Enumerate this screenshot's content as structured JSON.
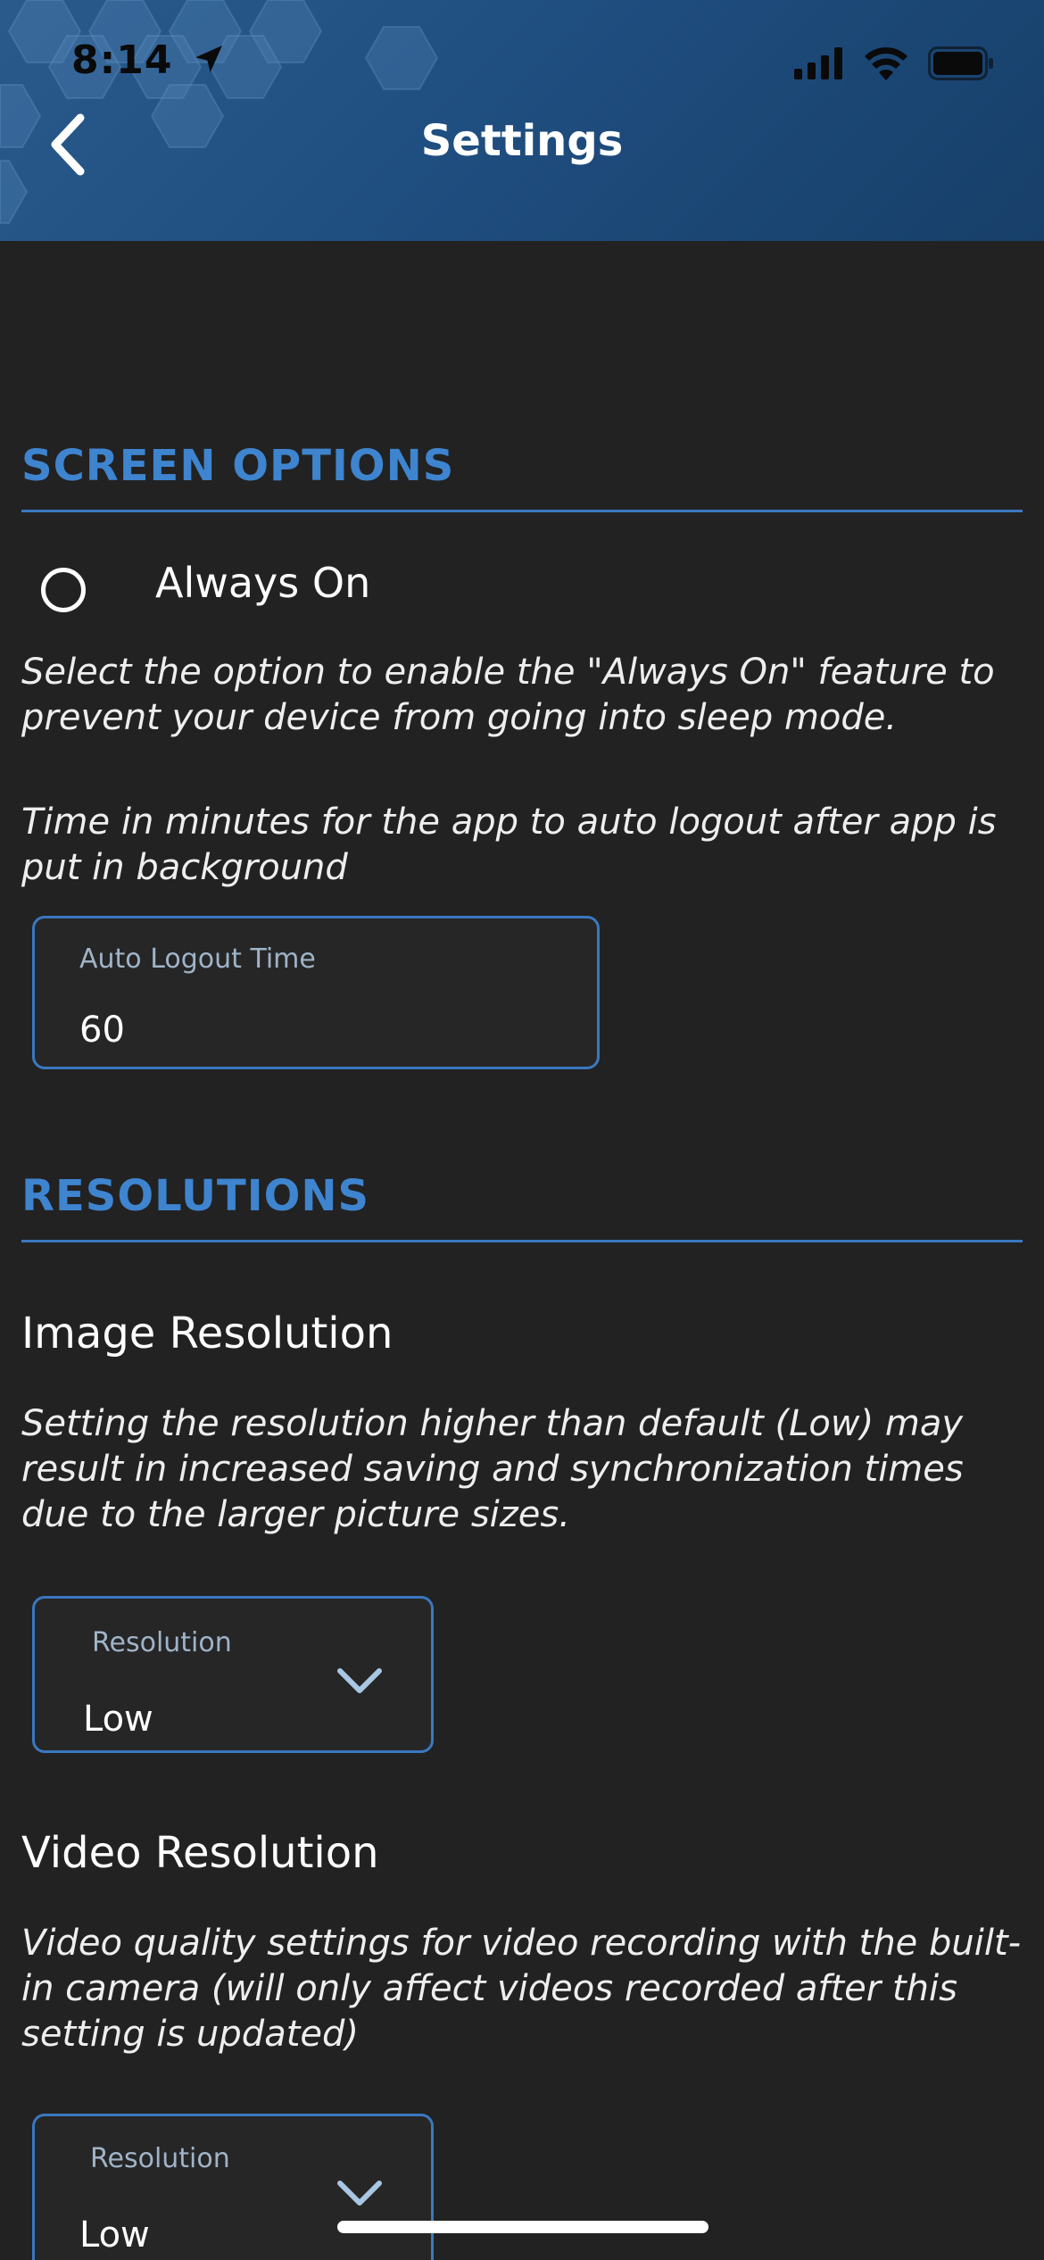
{
  "status_bar": {
    "time": "8:14"
  },
  "header": {
    "title": "Settings"
  },
  "screen_options": {
    "section_title": "SCREEN OPTIONS",
    "always_on_label": "Always On",
    "always_on_selected": false,
    "always_on_description": "Select the option to enable the \"Always On\" feature to prevent your device from going into sleep mode.",
    "auto_logout_description": "Time in minutes for the app to auto logout after app is put in background",
    "auto_logout_field": {
      "label": "Auto Logout Time",
      "value": "60"
    }
  },
  "resolutions": {
    "section_title": "RESOLUTIONS",
    "image": {
      "heading": "Image Resolution",
      "description": "Setting the resolution higher than default (Low) may result in increased saving and synchronization times due to the larger picture sizes.",
      "select_label": "Resolution",
      "select_value": "Low"
    },
    "video": {
      "heading": "Video Resolution",
      "description": "Video quality settings for video recording with the built-in camera (will only affect videos recorded after this setting is updated)",
      "select_label": "Resolution",
      "select_value": "Low"
    }
  },
  "colors": {
    "accent": "#3e84cf",
    "background": "#222222",
    "header": "#1f4e80"
  },
  "icons": {
    "back": "chevron-left-icon",
    "location": "location-arrow-icon",
    "signal": "cellular-signal-icon",
    "wifi": "wifi-icon",
    "battery": "battery-icon",
    "dropdown": "chevron-down-icon"
  }
}
